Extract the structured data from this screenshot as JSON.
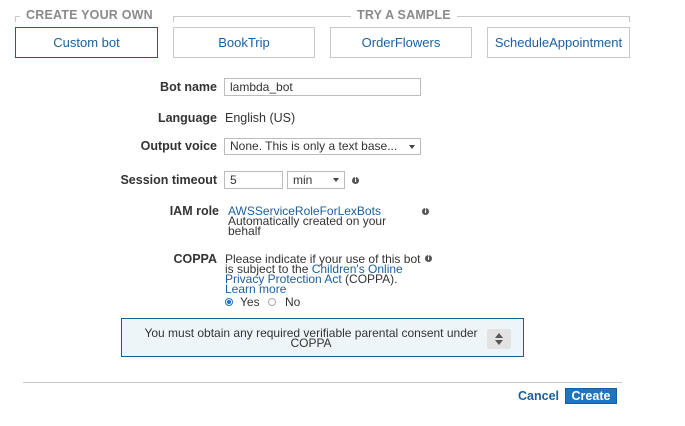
{
  "sections": {
    "create_your_own": "CREATE YOUR OWN",
    "try_a_sample": "TRY A SAMPLE"
  },
  "bot_options": {
    "custom": "Custom bot",
    "samples": [
      "BookTrip",
      "OrderFlowers",
      "ScheduleAppointment"
    ],
    "selected": "Custom bot"
  },
  "form": {
    "bot_name": {
      "label": "Bot name",
      "value": "lambda_bot"
    },
    "language": {
      "label": "Language",
      "value": "English (US)"
    },
    "output_voice": {
      "label": "Output voice",
      "value": "None. This is only a text base..."
    },
    "session_timeout": {
      "label": "Session timeout",
      "value": "5",
      "unit": "min"
    },
    "iam_role": {
      "label": "IAM role",
      "role_name": "AWSServiceRoleForLexBots",
      "desc_line1": "Automatically created on your",
      "desc_line2": "behalf"
    },
    "coppa": {
      "label": "COPPA",
      "line1": "Please indicate if your use of this bot",
      "line2_pre": "is subject to the ",
      "line2_link": "Children's Online",
      "line3_link": "Privacy Protection Act",
      "line3_post": " (COPPA).",
      "learn_more": "Learn more",
      "yes": "Yes",
      "no": "No",
      "selected": "Yes"
    }
  },
  "alert": {
    "line1": "You must obtain any required verifiable parental consent under",
    "line2": "COPPA"
  },
  "footer": {
    "cancel": "Cancel",
    "create": "Create"
  },
  "colors": {
    "link": "#1b5f9f",
    "primary_button": "#2073bf",
    "alert_border": "#1a5d88",
    "alert_bg": "#eef5f8"
  },
  "icons": [
    "info-icon",
    "dropdown-caret-icon",
    "scroll-arrows-icon"
  ]
}
